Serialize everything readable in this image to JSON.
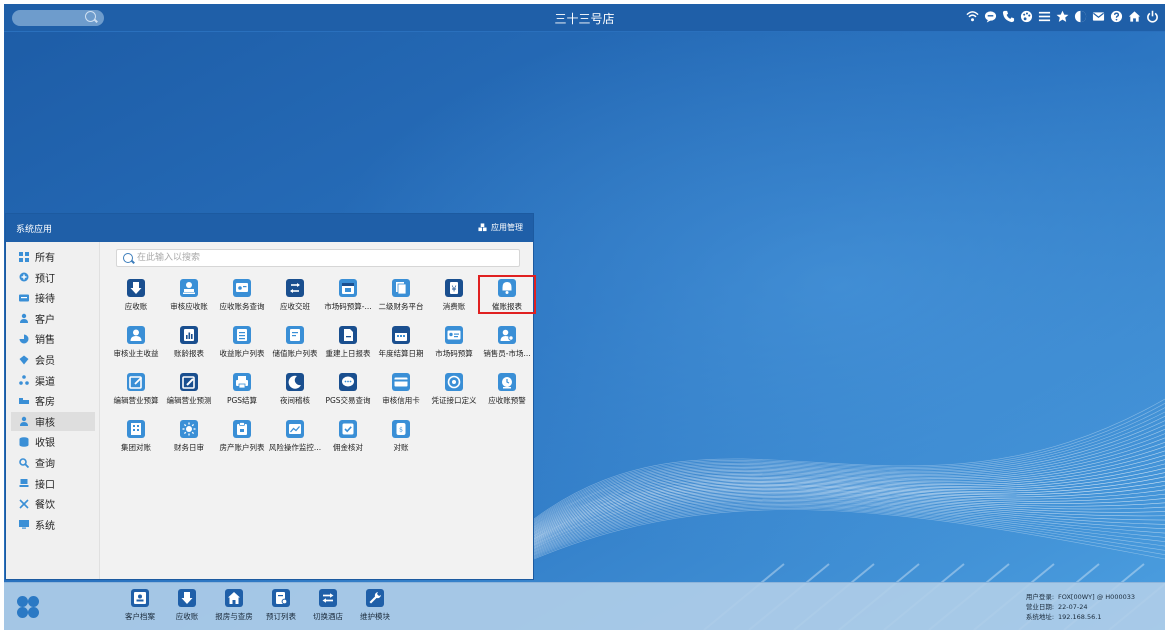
{
  "store_title": "三十三号店",
  "top_icons": [
    "wifi-icon",
    "chat-bubble-icon",
    "phone-icon",
    "palette-icon",
    "menu-icon",
    "star-icon",
    "contrast-icon",
    "mail-icon",
    "help-icon",
    "home-icon",
    "power-icon"
  ],
  "app_window": {
    "title": "系统应用",
    "manage_label": "应用管理",
    "search_placeholder": "在此输入以搜索"
  },
  "sidebar": [
    {
      "label": "所有",
      "icon": "grid-icon"
    },
    {
      "label": "预订",
      "icon": "plus-circle-icon"
    },
    {
      "label": "接待",
      "icon": "card-icon"
    },
    {
      "label": "客户",
      "icon": "user-icon"
    },
    {
      "label": "销售",
      "icon": "pie-icon"
    },
    {
      "label": "会员",
      "icon": "diamond-icon"
    },
    {
      "label": "渠道",
      "icon": "network-icon"
    },
    {
      "label": "客房",
      "icon": "bed-icon"
    },
    {
      "label": "审核",
      "icon": "user-check-icon",
      "active": true
    },
    {
      "label": "收银",
      "icon": "database-icon"
    },
    {
      "label": "查询",
      "icon": "search-icon"
    },
    {
      "label": "接口",
      "icon": "plug-icon"
    },
    {
      "label": "餐饮",
      "icon": "utensils-icon"
    },
    {
      "label": "系统",
      "icon": "monitor-icon"
    }
  ],
  "apps": [
    {
      "label": "应收账",
      "icon": "download-icon"
    },
    {
      "label": "审核应收账",
      "icon": "user-stamp-icon"
    },
    {
      "label": "应收账务查询",
      "icon": "card-search-icon"
    },
    {
      "label": "应收交班",
      "icon": "swap-icon"
    },
    {
      "label": "市场码预算-...",
      "icon": "calendar-icon"
    },
    {
      "label": "二级财务平台",
      "icon": "stack-icon"
    },
    {
      "label": "消费账",
      "icon": "yen-icon"
    },
    {
      "label": "催账报表",
      "icon": "bell-icon",
      "highlight": true
    },
    {
      "label": "审核业主收益",
      "icon": "user-icon"
    },
    {
      "label": "账龄报表",
      "icon": "chart-doc-icon"
    },
    {
      "label": "收益账户列表",
      "icon": "list-icon"
    },
    {
      "label": "储值账户列表",
      "icon": "list-doc-icon"
    },
    {
      "label": "重建上日报表",
      "icon": "file-icon"
    },
    {
      "label": "年度结算日期",
      "icon": "calendar-grid-icon"
    },
    {
      "label": "市场码预算",
      "icon": "id-card-icon"
    },
    {
      "label": "销售员-市场...",
      "icon": "users-gear-icon"
    },
    {
      "label": "编辑营业预算",
      "icon": "edit-box-icon"
    },
    {
      "label": "编辑营业预测",
      "icon": "pencil-icon"
    },
    {
      "label": "PGS结算",
      "icon": "printer-icon"
    },
    {
      "label": "夜间稽核",
      "icon": "moon-icon"
    },
    {
      "label": "PGS交易查询",
      "icon": "chat-dots-icon"
    },
    {
      "label": "审核信用卡",
      "icon": "credit-card-icon"
    },
    {
      "label": "凭证接口定义",
      "icon": "target-icon"
    },
    {
      "label": "应收账预警",
      "icon": "alarm-icon"
    },
    {
      "label": "集团对账",
      "icon": "building-icon"
    },
    {
      "label": "财务日审",
      "icon": "sun-icon"
    },
    {
      "label": "房产账户列表",
      "icon": "clipboard-icon"
    },
    {
      "label": "风险操作监控...",
      "icon": "image-chart-icon"
    },
    {
      "label": "佣金核对",
      "icon": "check-box-icon"
    },
    {
      "label": "对账",
      "icon": "phone-pad-icon"
    }
  ],
  "dock": [
    {
      "label": "客户档案",
      "icon": "contact-card-icon"
    },
    {
      "label": "应收账",
      "icon": "download-icon"
    },
    {
      "label": "报房与查房",
      "icon": "house-icon"
    },
    {
      "label": "预订列表",
      "icon": "doc-gear-icon"
    },
    {
      "label": "切换酒店",
      "icon": "swap-arrows-icon"
    },
    {
      "label": "维护模块",
      "icon": "wrench-icon"
    }
  ],
  "sysinfo": {
    "user_label": "用户登录:",
    "user_value": "FOX[00WY] @ H000033",
    "date_label": "营业日期:",
    "date_value": "22-07-24",
    "ip_label": "系统地址:",
    "ip_value": "192.168.56.1"
  },
  "colors": {
    "accent": "#1f5fa8",
    "tile_dark": "#1a4f8f",
    "tile_light": "#3a8fd6",
    "highlight_border": "#e02020"
  }
}
